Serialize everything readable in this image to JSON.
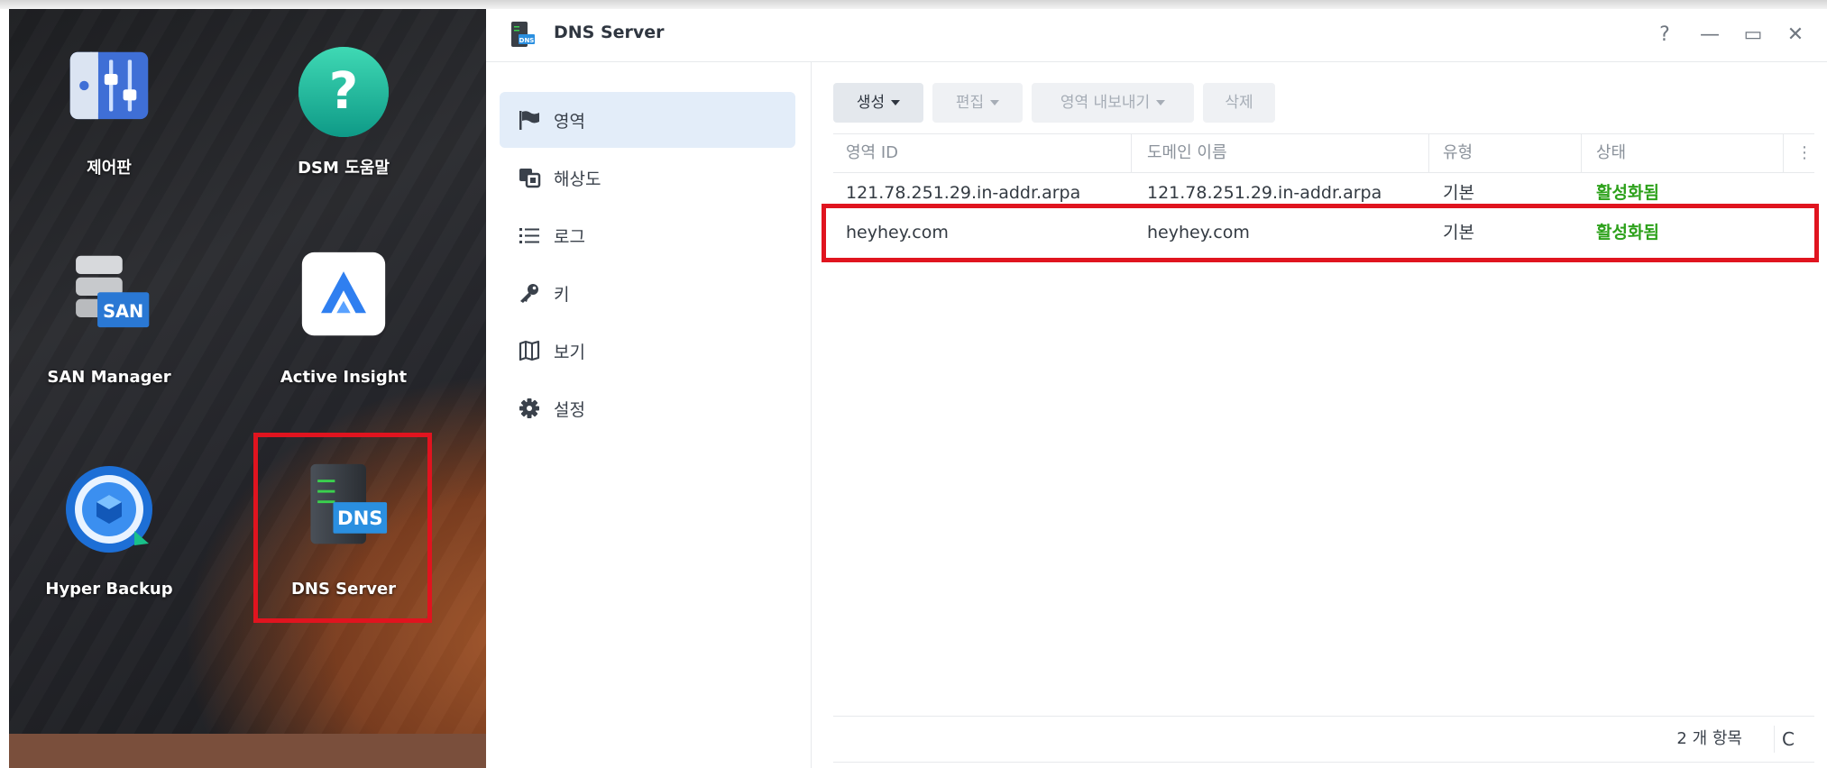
{
  "desktop": {
    "apps": [
      {
        "label": "제어판"
      },
      {
        "label": "DSM 도움말"
      },
      {
        "label": "SAN Manager"
      },
      {
        "label": "Active Insight"
      },
      {
        "label": "Hyper Backup"
      },
      {
        "label": "DNS Server"
      }
    ],
    "san_badge": "SAN",
    "dns_badge": "DNS"
  },
  "window": {
    "title": "DNS Server",
    "title_icon_badge": "DNS",
    "buttons": {
      "help": "?",
      "minimize": "—",
      "maximize": "▭",
      "close": "✕"
    }
  },
  "sidebar": {
    "items": [
      {
        "label": "영역",
        "icon": "flag-icon",
        "active": true
      },
      {
        "label": "해상도",
        "icon": "resolution-icon",
        "active": false
      },
      {
        "label": "로그",
        "icon": "list-icon",
        "active": false
      },
      {
        "label": "키",
        "icon": "key-icon",
        "active": false
      },
      {
        "label": "보기",
        "icon": "map-icon",
        "active": false
      },
      {
        "label": "설정",
        "icon": "gear-icon",
        "active": false
      }
    ]
  },
  "toolbar": {
    "create": "생성",
    "edit": "편집",
    "export": "영역 내보내기",
    "delete": "삭제"
  },
  "table": {
    "columns": [
      "영역 ID",
      "도메인 이름",
      "유형",
      "상태"
    ],
    "more_icon": "⋮",
    "rows": [
      {
        "zone_id": "121.78.251.29.in-addr.arpa",
        "domain": "121.78.251.29.in-addr.arpa",
        "type": "기본",
        "status": "활성화됨"
      },
      {
        "zone_id": "heyhey.com",
        "domain": "heyhey.com",
        "type": "기본",
        "status": "활성화됨"
      }
    ]
  },
  "footer": {
    "count": "2 개 항목",
    "refresh_icon": "C"
  },
  "colors": {
    "highlight_border": "#e0141f",
    "status_active": "#2da11b",
    "nav_active_bg": "#e3edf9"
  }
}
